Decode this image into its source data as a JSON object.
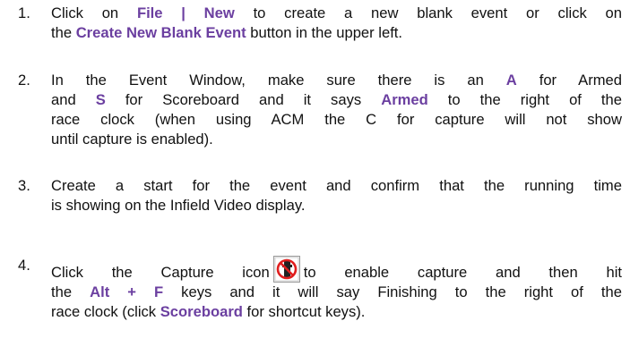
{
  "steps": [
    {
      "number": "1.",
      "l1_a": "Click on ",
      "l1_b": "File | New",
      "l1_c": " to create a new blank event or click on",
      "l2_a": "the ",
      "l2_b": "Create New Blank Event",
      "l2_c": " button in the upper left."
    },
    {
      "number": "2.",
      "l1_a": "In the Event Window, make sure there is an ",
      "l1_b": "A",
      "l1_c": " for Armed",
      "l2_a": "and ",
      "l2_b": "S",
      "l2_c": " for Scoreboard and it says ",
      "l2_d": "Armed",
      "l2_e": " to the right of the",
      "l3": "race clock (when using ACM the C for capture will not show",
      "l4": "until capture is enabled)."
    },
    {
      "number": "3.",
      "l1": "Create a start for the event and confirm that the running time",
      "l2": "is showing on the Infield Video display."
    },
    {
      "number": "4.",
      "l1_a": "Click the Capture icon",
      "l1_b": "to enable capture and then hit",
      "l2_a": "the ",
      "l2_b": "Alt + F",
      "l2_c": " keys and it will say Finishing to the right of the",
      "l3_a": "race clock (click ",
      "l3_b": "Scoreboard",
      "l3_c": " for shortcut keys).",
      "icon": "capture-disabled-icon"
    }
  ],
  "colors": {
    "highlight": "#6b3fa0",
    "text": "#111111",
    "icon_red": "#e01e1e"
  }
}
